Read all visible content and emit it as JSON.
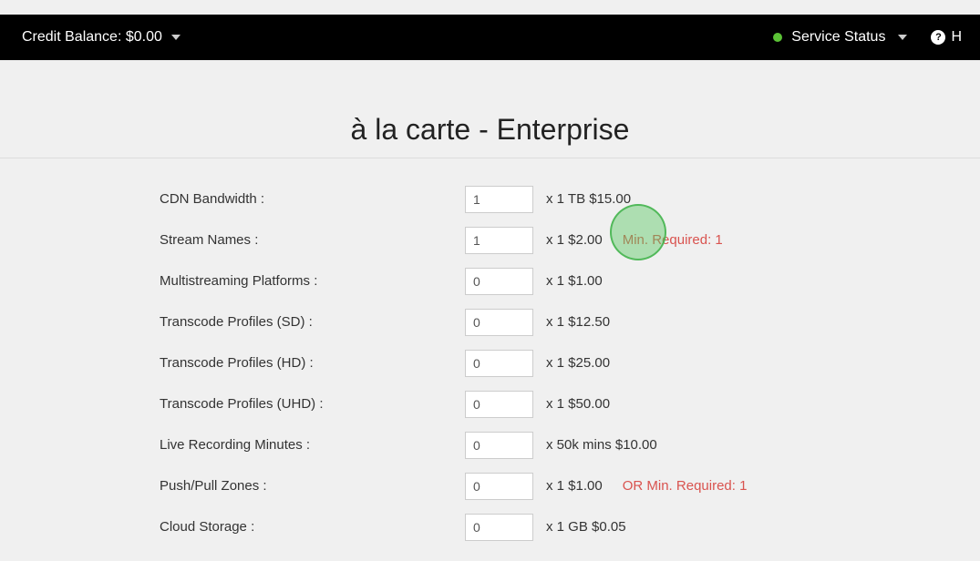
{
  "topbar": {
    "credit_label": "Credit Balance: $0.00",
    "service_status_label": "Service Status",
    "help_label": "H"
  },
  "page": {
    "title": "à la carte - Enterprise"
  },
  "rows": [
    {
      "label": "CDN Bandwidth :",
      "value": "1",
      "unit": "x 1 TB $15.00",
      "warn": ""
    },
    {
      "label": "Stream Names :",
      "value": "1",
      "unit": "x 1 $2.00",
      "warn": "Min. Required: 1"
    },
    {
      "label": "Multistreaming Platforms :",
      "value": "0",
      "unit": "x 1 $1.00",
      "warn": ""
    },
    {
      "label": "Transcode Profiles (SD) :",
      "value": "0",
      "unit": "x 1 $12.50",
      "warn": ""
    },
    {
      "label": "Transcode Profiles (HD) :",
      "value": "0",
      "unit": "x 1 $25.00",
      "warn": ""
    },
    {
      "label": "Transcode Profiles (UHD) :",
      "value": "0",
      "unit": "x 1 $50.00",
      "warn": ""
    },
    {
      "label": "Live Recording Minutes :",
      "value": "0",
      "unit": "x 50k mins $10.00",
      "warn": ""
    },
    {
      "label": "Push/Pull Zones :",
      "value": "0",
      "unit": "x 1 $1.00",
      "warn": "OR Min. Required: 1"
    },
    {
      "label": "Cloud Storage :",
      "value": "0",
      "unit": "x 1 GB $0.05",
      "warn": ""
    }
  ]
}
